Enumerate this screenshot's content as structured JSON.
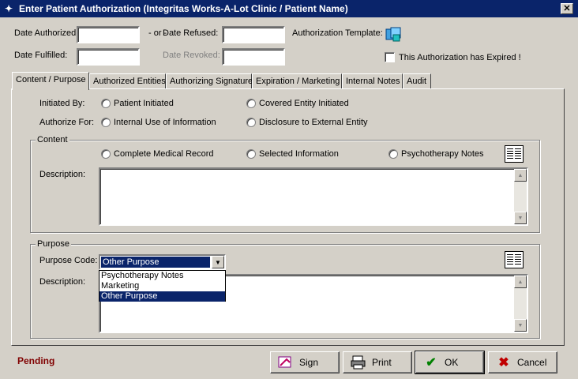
{
  "window": {
    "title": "Enter Patient Authorization (Integritas Works-A-Lot Clinic / Patient Name)",
    "close_symbol": "✕"
  },
  "header": {
    "date_authorized_label": "Date Authorized:",
    "or_label": "- or -",
    "date_refused_label": "Date Refused:",
    "authorization_template_label": "Authorization Template:",
    "date_fulfilled_label": "Date Fulfilled:",
    "date_revoked_label": "Date Revoked:",
    "expired_label": "This Authorization has Expired !",
    "date_authorized_value": "",
    "date_refused_value": "",
    "date_fulfilled_value": "",
    "date_revoked_value": ""
  },
  "tabs": [
    {
      "label": "Content / Purpose",
      "active": true
    },
    {
      "label": "Authorized Entities"
    },
    {
      "label": "Authorizing Signature"
    },
    {
      "label": "Expiration / Marketing"
    },
    {
      "label": "Internal Notes"
    },
    {
      "label": "Audit"
    }
  ],
  "content_tab": {
    "initiated_by_label": "Initiated By:",
    "patient_initiated": "Patient Initiated",
    "covered_entity_initiated": "Covered Entity Initiated",
    "authorize_for_label": "Authorize For:",
    "internal_use": "Internal Use of Information",
    "disclosure_external": "Disclosure to External Entity",
    "content_group_title": "Content",
    "complete_record": "Complete Medical Record",
    "selected_info": "Selected Information",
    "psychotherapy_notes": "Psychotherapy Notes",
    "description_label": "Description:",
    "purpose_group_title": "Purpose",
    "purpose_code_label": "Purpose Code:",
    "purpose_code_value": "Other Purpose",
    "purpose_description_label": "Description:",
    "purpose_options": [
      "Psychotherapy Notes",
      "Marketing",
      "Other Purpose"
    ]
  },
  "footer": {
    "status": "Pending",
    "sign_label": "Sign",
    "print_label": "Print",
    "ok_label": "OK",
    "cancel_label": "Cancel"
  },
  "icons": {
    "app": "app-icon",
    "template": "template-icon",
    "book": "book-icon",
    "sign": "sign-icon",
    "print": "printer-icon",
    "ok": "checkmark-icon",
    "cancel": "x-icon"
  },
  "colors": {
    "titlebar": "#0a246a",
    "status": "#800000",
    "ok_check": "#008000",
    "cancel_x": "#c00000"
  }
}
